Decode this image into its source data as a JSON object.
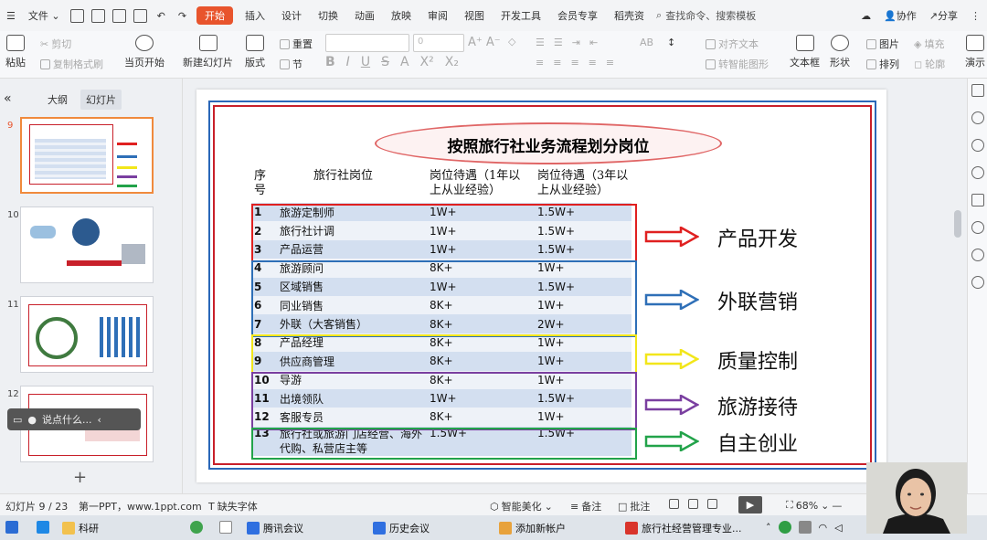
{
  "titlebar": {
    "file_menu": "文件",
    "tabs": [
      "开始",
      "插入",
      "设计",
      "切换",
      "动画",
      "放映",
      "审阅",
      "视图",
      "开发工具",
      "会员专享",
      "稻壳资"
    ],
    "search_placeholder": "查找命令、搜索模板",
    "collab": "协作",
    "share": "分享"
  },
  "ribbon": {
    "paste": "粘贴",
    "cut": "剪切",
    "copy": "复制",
    "format_painter": "格式刷",
    "start_from_current": "当页开始",
    "new_slide": "新建幻灯片",
    "layout": "版式",
    "reset": "重置",
    "section": "节",
    "font_size": "0",
    "align_text": "对齐文本",
    "smart_shape": "转智能图形",
    "textbox": "文本框",
    "shape": "形状",
    "picture": "图片",
    "fill": "填充",
    "arrange": "排列",
    "outline": "轮廓",
    "more": "演示"
  },
  "leftpanel": {
    "tab_outline": "大纲",
    "tab_slides": "幻灯片",
    "slides": [
      {
        "num": "9"
      },
      {
        "num": "10"
      },
      {
        "num": "11"
      },
      {
        "num": "12"
      }
    ],
    "floater_text": "说点什么..."
  },
  "slide": {
    "title": "按照旅行社业务流程划分岗位",
    "headers": [
      "序号",
      "旅行社岗位",
      "岗位待遇（1年以上从业经验）",
      "岗位待遇（3年以上从业经验）"
    ],
    "rows": [
      {
        "no": "1",
        "job": "旅游定制师",
        "pay1": "1W+",
        "pay3": "1.5W+"
      },
      {
        "no": "2",
        "job": "旅行社计调",
        "pay1": "1W+",
        "pay3": "1.5W+"
      },
      {
        "no": "3",
        "job": "产品运营",
        "pay1": "1W+",
        "pay3": "1.5W+"
      },
      {
        "no": "4",
        "job": "旅游顾问",
        "pay1": "8K+",
        "pay3": "1W+"
      },
      {
        "no": "5",
        "job": "区域销售",
        "pay1": "1W+",
        "pay3": "1.5W+"
      },
      {
        "no": "6",
        "job": "同业销售",
        "pay1": "8K+",
        "pay3": "1W+"
      },
      {
        "no": "7",
        "job": "外联（大客销售）",
        "pay1": "8K+",
        "pay3": "2W+"
      },
      {
        "no": "8",
        "job": "产品经理",
        "pay1": "8K+",
        "pay3": "1W+"
      },
      {
        "no": "9",
        "job": "供应商管理",
        "pay1": "8K+",
        "pay3": "1W+"
      },
      {
        "no": "10",
        "job": "导游",
        "pay1": "8K+",
        "pay3": "1W+"
      },
      {
        "no": "11",
        "job": "出境领队",
        "pay1": "1W+",
        "pay3": "1.5W+"
      },
      {
        "no": "12",
        "job": "客服专员",
        "pay1": "8K+",
        "pay3": "1W+"
      },
      {
        "no": "13",
        "job": "旅行社或旅游门店经营、海外代购、私营店主等",
        "pay1": "1.5W+",
        "pay3": "1.5W+"
      }
    ],
    "categories": [
      {
        "label": "产品开发",
        "color": "#e02020"
      },
      {
        "label": "外联营销",
        "color": "#2e6fb7"
      },
      {
        "label": "质量控制",
        "color": "#f2e61a"
      },
      {
        "label": "旅游接待",
        "color": "#7a3fa0"
      },
      {
        "label": "自主创业",
        "color": "#22a34a"
      }
    ]
  },
  "statusbar": {
    "slide_count": "幻灯片 9 / 23",
    "theme": "第一PPT，www.1ppt.com",
    "missing_font": "缺失字体",
    "beautify": "智能美化",
    "notes": "备注",
    "comment": "批注",
    "zoom": "68%"
  },
  "taskbar": {
    "items": [
      "科研",
      "腾讯会议",
      "历史会议",
      "添加新帐户",
      "旅行社经营管理专业..."
    ]
  }
}
